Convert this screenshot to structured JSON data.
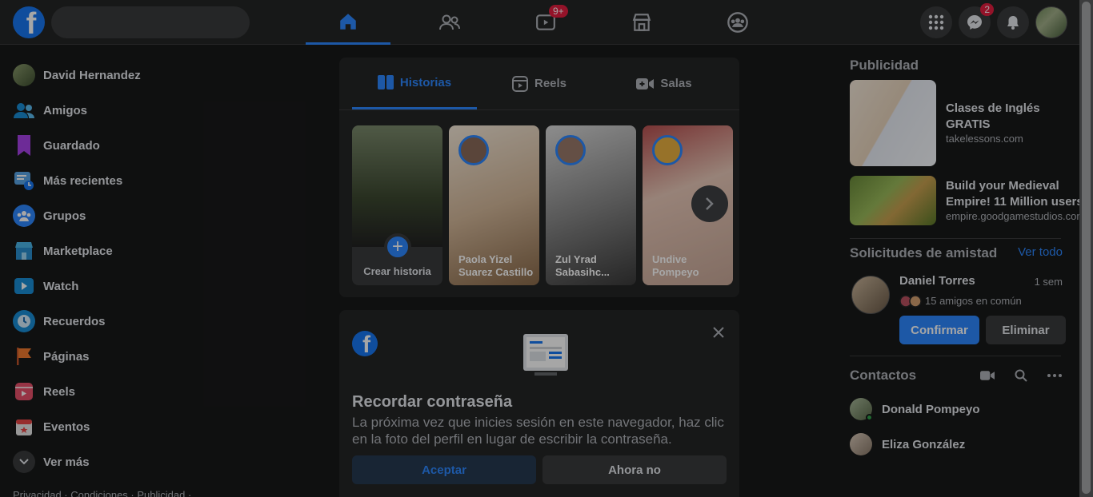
{
  "topbar": {
    "search_placeholder": "",
    "nav_badges": {
      "watch": "9+"
    },
    "messenger_badge": "2"
  },
  "leftnav": {
    "items": [
      {
        "label": "David Hernandez",
        "icon": "profile-avatar"
      },
      {
        "label": "Amigos",
        "icon": "friends-icon"
      },
      {
        "label": "Guardado",
        "icon": "bookmark-icon"
      },
      {
        "label": "Más recientes",
        "icon": "recent-icon"
      },
      {
        "label": "Grupos",
        "icon": "groups-icon"
      },
      {
        "label": "Marketplace",
        "icon": "marketplace-icon"
      },
      {
        "label": "Watch",
        "icon": "watch-icon"
      },
      {
        "label": "Recuerdos",
        "icon": "memories-icon"
      },
      {
        "label": "Páginas",
        "icon": "pages-icon"
      },
      {
        "label": "Reels",
        "icon": "reels-icon"
      },
      {
        "label": "Eventos",
        "icon": "events-icon"
      },
      {
        "label": "Ver más",
        "icon": "chevron-down-icon"
      }
    ],
    "footer": "Privacidad · Condiciones · Publicidad ·"
  },
  "stories": {
    "tabs": [
      {
        "label": "Historias"
      },
      {
        "label": "Reels"
      },
      {
        "label": "Salas"
      }
    ],
    "create_label": "Crear historia",
    "items": [
      {
        "name": "Paola Yizel Suarez Castillo"
      },
      {
        "name": "Zul Yrad Sabasihc..."
      },
      {
        "name": "Undive Pompeyo"
      }
    ]
  },
  "password_card": {
    "title": "Recordar contraseña",
    "text": "La próxima vez que inicies sesión en este navegador, haz clic en la foto del perfil en lugar de escribir la contraseña.",
    "accept_label": "Aceptar",
    "not_now_label": "Ahora no"
  },
  "right": {
    "ads_title": "Publicidad",
    "ads": [
      {
        "title": "Clases de Inglés GRATIS",
        "url": "takelessons.com"
      },
      {
        "title": "Build your Medieval Empire! 11 Million users",
        "url": "empire.goodgamestudios.com"
      }
    ],
    "requests_title": "Solicitudes de amistad",
    "see_all": "Ver todo",
    "request": {
      "name": "Daniel Torres",
      "time": "1 sem",
      "mutual": "15 amigos en común",
      "confirm_label": "Confirmar",
      "delete_label": "Eliminar"
    },
    "contacts_title": "Contactos",
    "contacts": [
      {
        "name": "Donald Pompeyo"
      },
      {
        "name": "Eliza González"
      }
    ]
  },
  "colors": {
    "accent": "#2d88ff",
    "badge": "#e41e3f",
    "bg": "#18191a",
    "surface": "#242526"
  }
}
